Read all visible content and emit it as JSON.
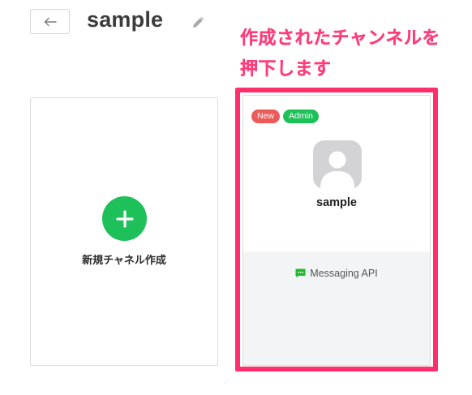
{
  "header": {
    "back_label": "←",
    "title": "sample",
    "edit_icon": "pencil-icon"
  },
  "annotation": {
    "line1": "作成されたチャンネルを",
    "line2": "押下します",
    "color": "#ff3d7a"
  },
  "create_card": {
    "label": "新規チャネル作成",
    "plus_icon": "plus-icon",
    "accent": "#1ec05a"
  },
  "channel_card": {
    "badges": [
      {
        "label": "New",
        "color": "#ec5a5a"
      },
      {
        "label": "Admin",
        "color": "#1ec05a"
      }
    ],
    "avatar_icon": "default-avatar-icon",
    "name": "sample",
    "type_icon": "messaging-icon",
    "type_label": "Messaging API"
  },
  "highlight_color": "#ff2f6d"
}
